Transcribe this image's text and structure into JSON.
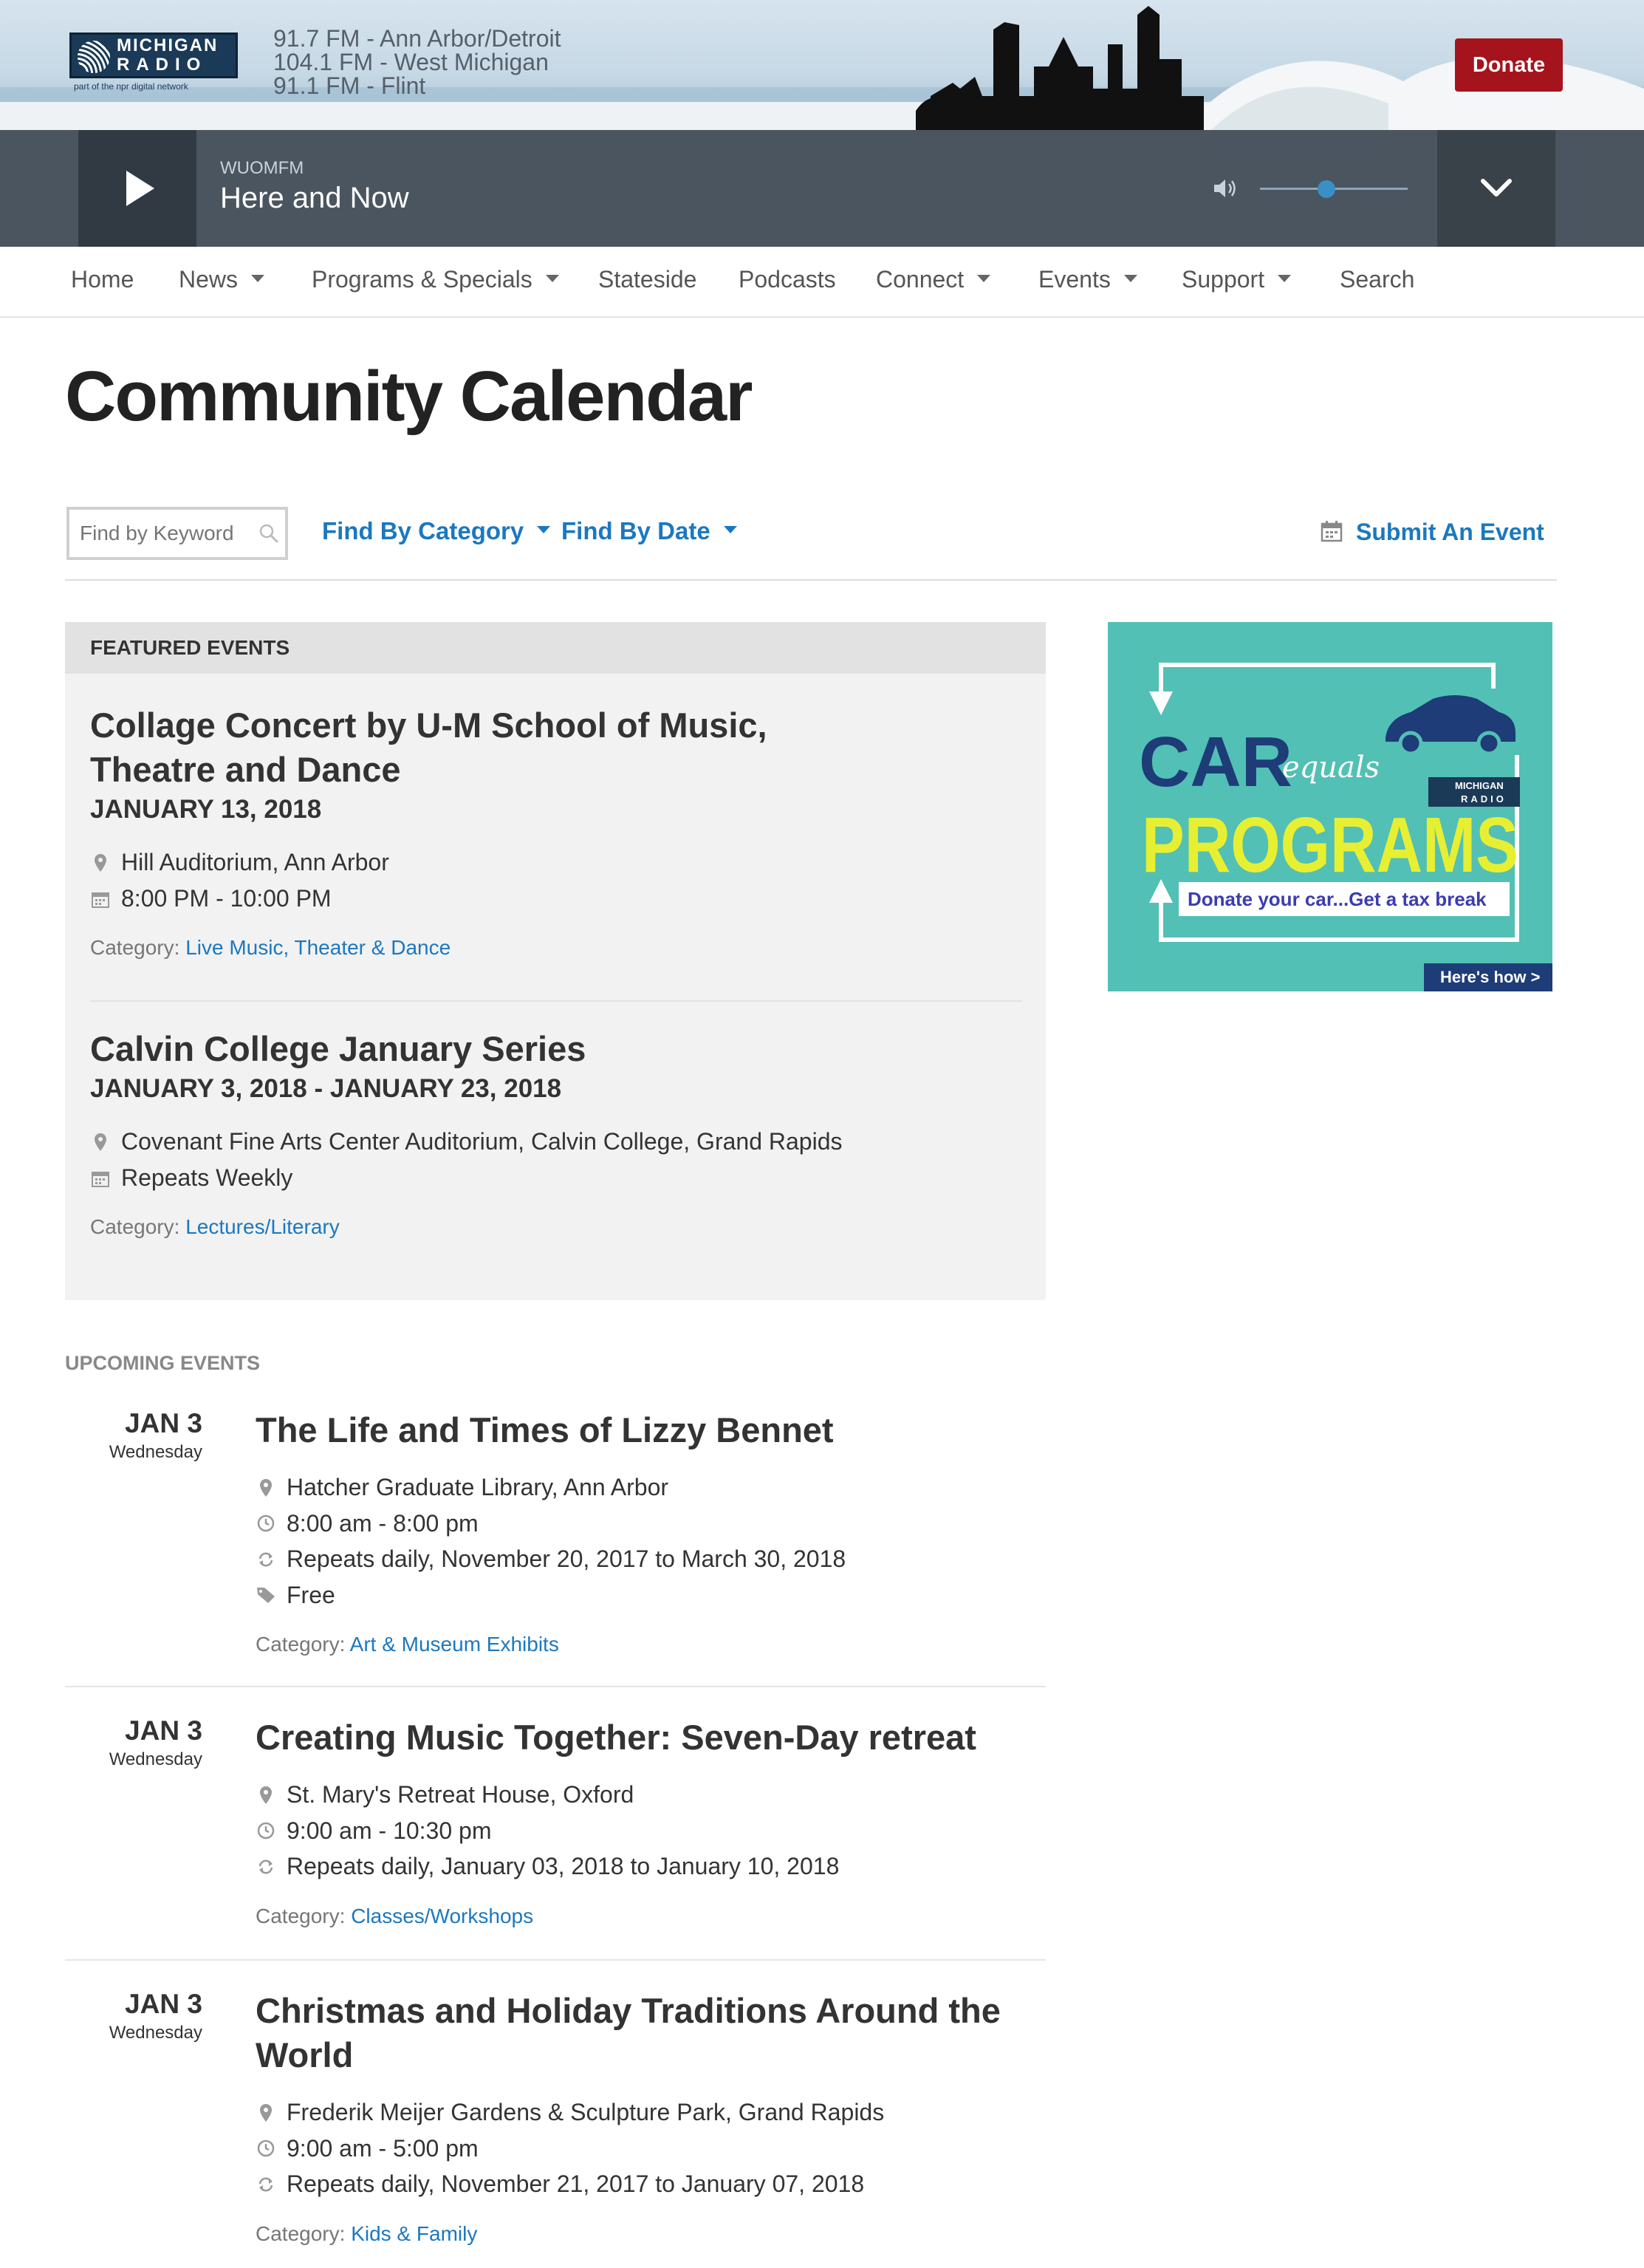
{
  "header": {
    "logo_line1": "MICHIGAN",
    "logo_line2": "RADIO",
    "logo_sub": "part of the npr digital network",
    "frequencies": [
      "91.7 FM - Ann Arbor/Detroit",
      "104.1 FM - West Michigan",
      "91.1 FM - Flint"
    ],
    "donate_label": "Donate"
  },
  "player": {
    "station": "WUOMFM",
    "program": "Here and Now",
    "volume_level": 0.45
  },
  "nav": {
    "items": [
      {
        "label": "Home"
      },
      {
        "label": "News"
      },
      {
        "label": "Programs & Specials"
      },
      {
        "label": "Stateside"
      },
      {
        "label": "Podcasts"
      },
      {
        "label": "Connect"
      },
      {
        "label": "Events"
      },
      {
        "label": "Support"
      },
      {
        "label": "Search"
      }
    ]
  },
  "page": {
    "title": "Community Calendar"
  },
  "filters": {
    "keyword_placeholder": "Find by Keyword",
    "category_label": "Find By Category",
    "date_label": "Find By Date",
    "submit_label": "Submit An Event"
  },
  "featured": {
    "heading": "FEATURED EVENTS",
    "events": [
      {
        "title_line1": "Collage Concert by U-M School of Music,",
        "title_line2": "Theatre and Dance",
        "date": "JANUARY 13, 2018",
        "location": "Hill Auditorium, Ann Arbor",
        "time": "8:00 PM - 10:00 PM",
        "category_label": "Category:",
        "category": "Live Music, Theater & Dance"
      },
      {
        "title_line1": "Calvin College January Series",
        "date": "JANUARY 3, 2018 - JANUARY 23, 2018",
        "location": "Covenant Fine Arts Center Auditorium, Calvin College, Grand Rapids",
        "time": "Repeats Weekly",
        "category_label": "Category:",
        "category": "Lectures/Literary"
      }
    ]
  },
  "ad": {
    "word1": "CAR",
    "word2": "equals",
    "word3": "PROGRAMS",
    "tagline": "Donate your car...Get a tax break",
    "cta": "Here's how >",
    "brand1": "MICHIGAN",
    "brand2": "RADIO"
  },
  "upcoming": {
    "heading": "UPCOMING EVENTS",
    "events": [
      {
        "month_day": "JAN 3",
        "weekday": "Wednesday",
        "title_line1": "The Life and Times of Lizzy Bennet",
        "location": "Hatcher Graduate Library, Ann Arbor",
        "time": "8:00 am - 8:00 pm",
        "repeats": "Repeats daily, November 20, 2017 to March 30, 2018",
        "price": "Free",
        "category_label": "Category:",
        "category": "Art & Museum Exhibits"
      },
      {
        "month_day": "JAN 3",
        "weekday": "Wednesday",
        "title_line1": "Creating Music Together: Seven-Day retreat",
        "location": "St. Mary's Retreat House, Oxford",
        "time": "9:00 am - 10:30 pm",
        "repeats": "Repeats daily, January 03, 2018 to January 10, 2018",
        "category_label": "Category:",
        "category": "Classes/Workshops"
      },
      {
        "month_day": "JAN 3",
        "weekday": "Wednesday",
        "title_line1": "Christmas and Holiday Traditions Around the",
        "title_line2": "World",
        "location": "Frederik Meijer Gardens & Sculpture Park, Grand Rapids",
        "time": "9:00 am - 5:00 pm",
        "repeats": "Repeats daily, November 21, 2017 to January 07, 2018",
        "category_label": "Category:",
        "category": "Kids & Family"
      }
    ]
  }
}
